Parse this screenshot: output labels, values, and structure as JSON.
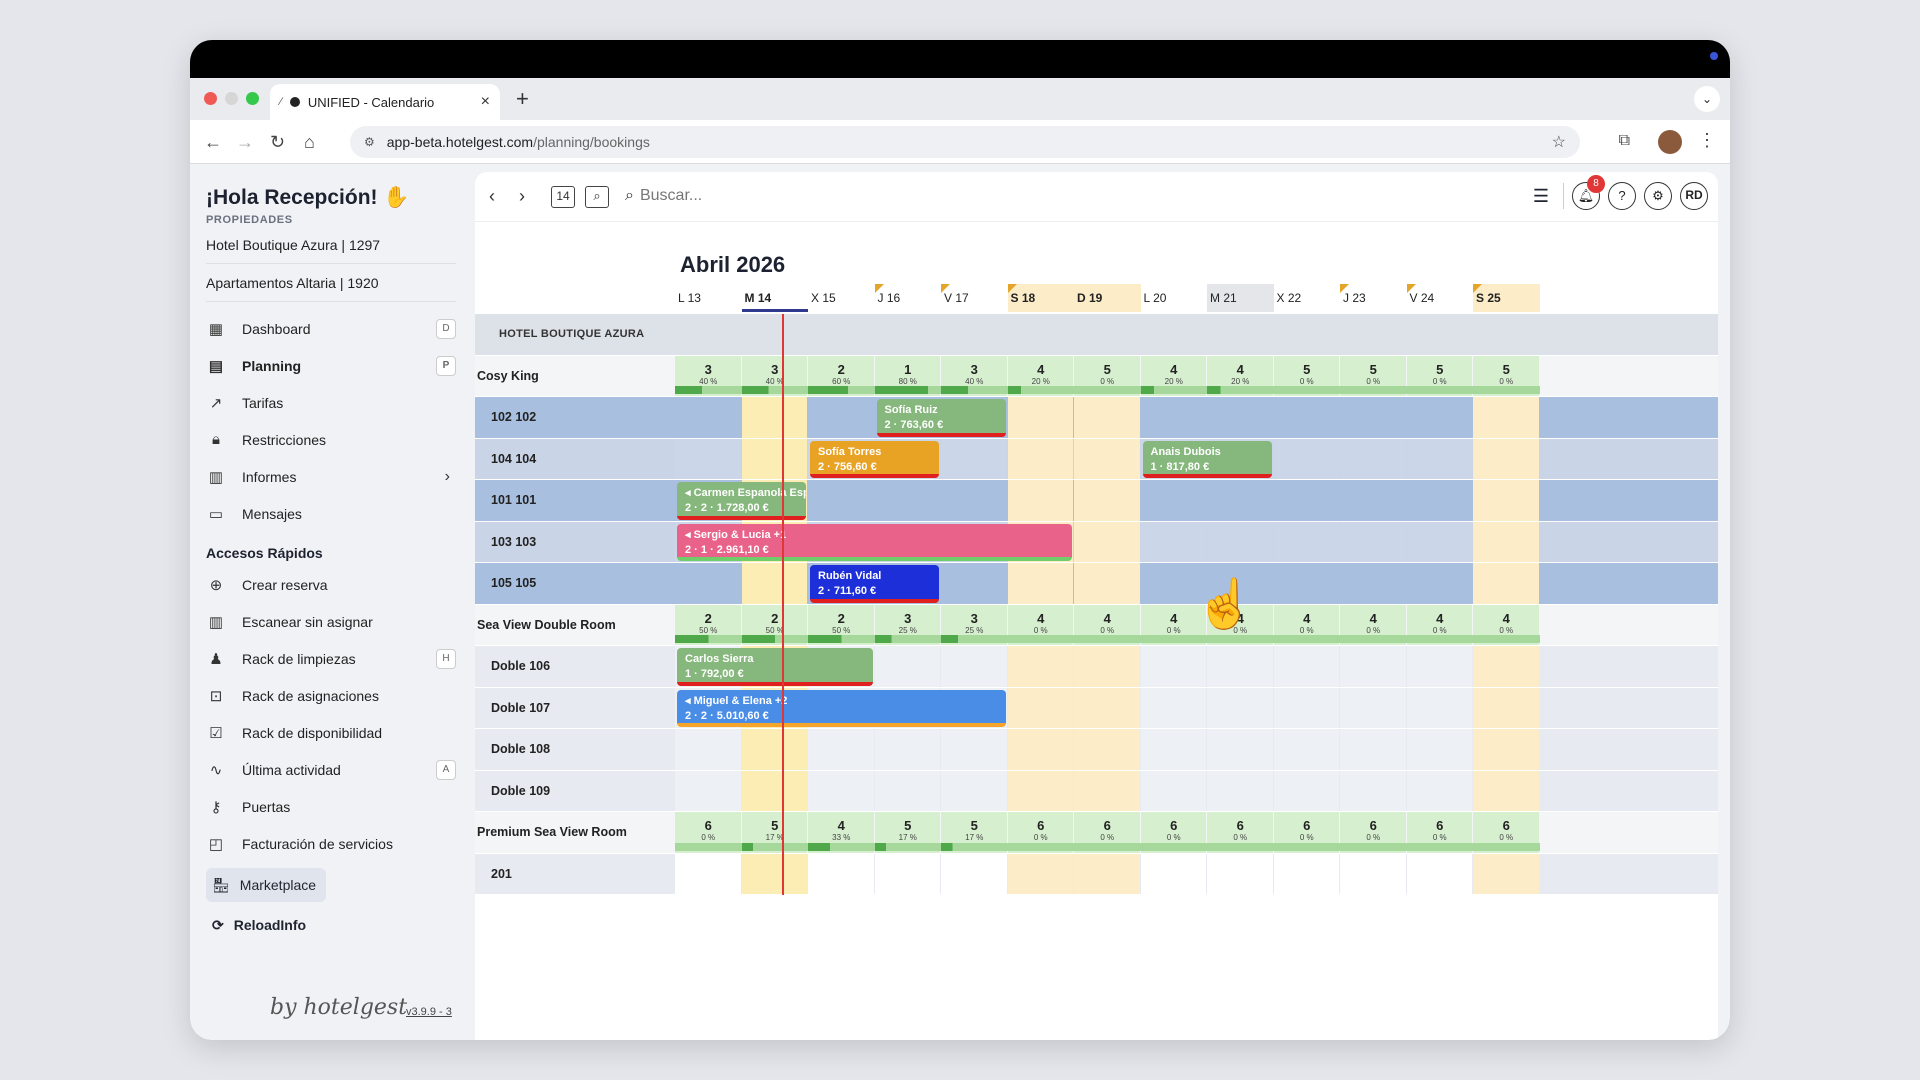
{
  "browser": {
    "tab_title": "UNIFIED - Calendario",
    "url_host": "app-beta.hotelgest.com",
    "url_path": "/planning/bookings"
  },
  "sidebar": {
    "greeting": "¡Hola Recepción!",
    "properties_label": "PROPIEDADES",
    "properties": [
      "Hotel Boutique Azura | 1297",
      "Apartamentos Altaria | 1920"
    ],
    "menu": [
      {
        "label": "Dashboard",
        "icon": "grid-icon",
        "key": "D"
      },
      {
        "label": "Planning",
        "icon": "calendar-icon",
        "key": "P"
      },
      {
        "label": "Tarifas",
        "icon": "trend-icon",
        "key": ""
      },
      {
        "label": "Restricciones",
        "icon": "lock-icon",
        "key": ""
      },
      {
        "label": "Informes",
        "icon": "report-icon",
        "key": ""
      },
      {
        "label": "Mensajes",
        "icon": "message-icon",
        "key": ""
      }
    ],
    "quick_label": "Accesos Rápidos",
    "quick": [
      {
        "label": "Crear reserva",
        "icon": "plus-circle-icon",
        "key": ""
      },
      {
        "label": "Escanear sin asignar",
        "icon": "barcode-icon",
        "key": ""
      },
      {
        "label": "Rack de limpiezas",
        "icon": "broom-icon",
        "key": "H"
      },
      {
        "label": "Rack de asignaciones",
        "icon": "assign-icon",
        "key": ""
      },
      {
        "label": "Rack de disponibilidad",
        "icon": "calendar-check-icon",
        "key": ""
      },
      {
        "label": "Última actividad",
        "icon": "activity-icon",
        "key": "A"
      },
      {
        "label": "Puertas",
        "icon": "key-icon",
        "key": ""
      },
      {
        "label": "Facturación de servicios",
        "icon": "bag-icon",
        "key": ""
      }
    ],
    "marketplace": "Marketplace",
    "reload": "ReloadInfo",
    "byline": "by hotelgest",
    "version": "v3.9.9 - 3"
  },
  "toolbar": {
    "search_placeholder": "Buscar...",
    "calendar_day": "14",
    "notifications": "8",
    "user_initials": "RD"
  },
  "calendar": {
    "month": "Abril 2026",
    "days": [
      "L 13",
      "M 14",
      "X 15",
      "J 16",
      "V 17",
      "S 18",
      "D 19",
      "L 20",
      "M 21",
      "X 22",
      "J 23",
      "V 24",
      "S 25"
    ],
    "hotel": "HOTEL BOUTIQUE AZURA",
    "room_types": [
      {
        "name": "Cosy King",
        "counts": [
          "3",
          "3",
          "2",
          "1",
          "3",
          "4",
          "5",
          "4",
          "4",
          "5",
          "5",
          "5",
          "5"
        ],
        "pcts": [
          "40 %",
          "40 %",
          "60 %",
          "80 %",
          "40 %",
          "20 %",
          "0 %",
          "20 %",
          "20 %",
          "0 %",
          "0 %",
          "0 %",
          "0 %"
        ],
        "rooms": [
          "102 102",
          "104 104",
          "101 101",
          "103 103",
          "105 105"
        ]
      },
      {
        "name": "Sea View Double Room",
        "counts": [
          "2",
          "2",
          "2",
          "3",
          "3",
          "4",
          "4",
          "4",
          "4",
          "4",
          "4",
          "4",
          "4"
        ],
        "pcts": [
          "50 %",
          "50 %",
          "50 %",
          "25 %",
          "25 %",
          "0 %",
          "0 %",
          "0 %",
          "0 %",
          "0 %",
          "0 %",
          "0 %",
          "0 %"
        ],
        "rooms": [
          "Doble 106",
          "Doble 107",
          "Doble 108",
          "Doble 109"
        ]
      },
      {
        "name": "Premium Sea View Room",
        "counts": [
          "6",
          "5",
          "4",
          "5",
          "5",
          "6",
          "6",
          "6",
          "6",
          "6",
          "6",
          "6",
          "6"
        ],
        "pcts": [
          "0 %",
          "17 %",
          "33 %",
          "17 %",
          "17 %",
          "0 %",
          "0 %",
          "0 %",
          "0 %",
          "0 %",
          "0 %",
          "0 %",
          "0 %"
        ],
        "rooms": [
          "201"
        ]
      }
    ],
    "bookings": [
      {
        "guest": "Sofía Ruiz",
        "details": "2 · 763,60 €"
      },
      {
        "guest": "Sofía Torres",
        "details": "2 · 756,60 €"
      },
      {
        "guest": "Anais Dubois",
        "details": "1 · 817,80 €"
      },
      {
        "guest": "Carmen Espanola Esp",
        "details": "2 · 2 · 1.728,00 €"
      },
      {
        "guest": "Sergio & Lucia +1",
        "details": "2 · 1 · 2.961,10 €"
      },
      {
        "guest": "Rubén Vidal",
        "details": "2 · 711,60 €"
      },
      {
        "guest": "Carlos Sierra",
        "details": "1 · 792,00 €"
      },
      {
        "guest": "Miguel & Elena +2",
        "details": "2 · 2 · 5.010,60 €"
      }
    ]
  }
}
